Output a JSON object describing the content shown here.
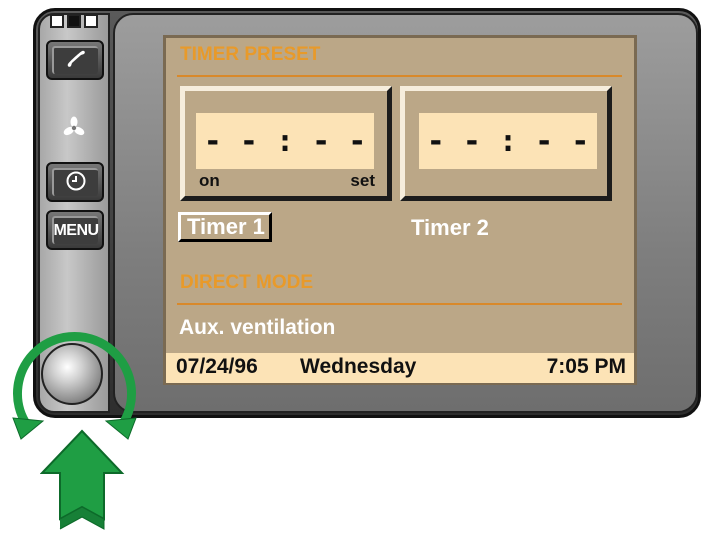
{
  "left_panel": {
    "menu_label": "MENU"
  },
  "screen": {
    "timer_preset": {
      "title": "TIMER PRESET",
      "timer1": {
        "display": "- - : - -",
        "left_label": "on",
        "right_label": "set",
        "name": "Timer 1"
      },
      "timer2": {
        "display": "- - : - -",
        "name": "Timer 2"
      }
    },
    "direct_mode": {
      "title": "DIRECT MODE",
      "item": "Aux. ventilation"
    },
    "status": {
      "date": "07/24/96",
      "weekday": "Wednesday",
      "time": "7:05 PM"
    }
  },
  "colors": {
    "screen_bg": "#bba787",
    "section_title": "#e89a2a",
    "display_bg": "#fce3b6",
    "arrow_green": "#1f9e44"
  },
  "icons": [
    "phone-icon",
    "fan-icon",
    "clock-icon",
    "rotate-arrow-icon",
    "push-arrow-icon"
  ]
}
